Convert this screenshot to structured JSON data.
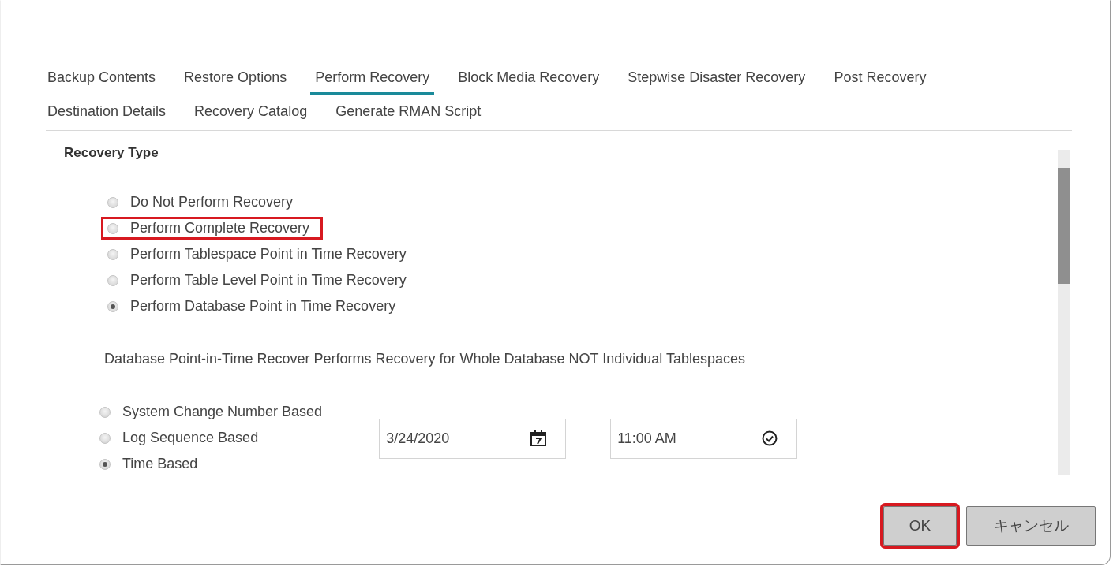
{
  "tabs": [
    {
      "label": "Backup Contents",
      "selected": false
    },
    {
      "label": "Restore Options",
      "selected": false
    },
    {
      "label": "Perform Recovery",
      "selected": true
    },
    {
      "label": "Block Media Recovery",
      "selected": false
    },
    {
      "label": "Stepwise Disaster Recovery",
      "selected": false
    },
    {
      "label": "Post Recovery",
      "selected": false
    },
    {
      "label": "Destination Details",
      "selected": false
    },
    {
      "label": "Recovery Catalog",
      "selected": false
    },
    {
      "label": "Generate RMAN Script",
      "selected": false
    }
  ],
  "section": {
    "heading": "Recovery Type"
  },
  "recovery_types": [
    {
      "label": "Do Not Perform Recovery",
      "selected": false,
      "highlighted": false
    },
    {
      "label": "Perform Complete Recovery",
      "selected": false,
      "highlighted": true
    },
    {
      "label": "Perform Tablespace Point in Time Recovery",
      "selected": false,
      "highlighted": false
    },
    {
      "label": "Perform Table Level Point in Time Recovery",
      "selected": false,
      "highlighted": false
    },
    {
      "label": "Perform Database Point in Time Recovery",
      "selected": true,
      "highlighted": false
    }
  ],
  "note": "Database Point-in-Time Recover Performs Recovery for Whole Database NOT Individual Tablespaces",
  "point_in_time_options": [
    {
      "label": "System Change Number Based",
      "selected": false
    },
    {
      "label": "Log Sequence Based",
      "selected": false
    },
    {
      "label": "Time Based",
      "selected": true
    }
  ],
  "date_field": {
    "value": "3/24/2020"
  },
  "time_field": {
    "value": "11:00 AM"
  },
  "buttons": [
    {
      "label": "OK",
      "highlighted": true
    },
    {
      "label": "キャンセル",
      "highlighted": false
    }
  ]
}
